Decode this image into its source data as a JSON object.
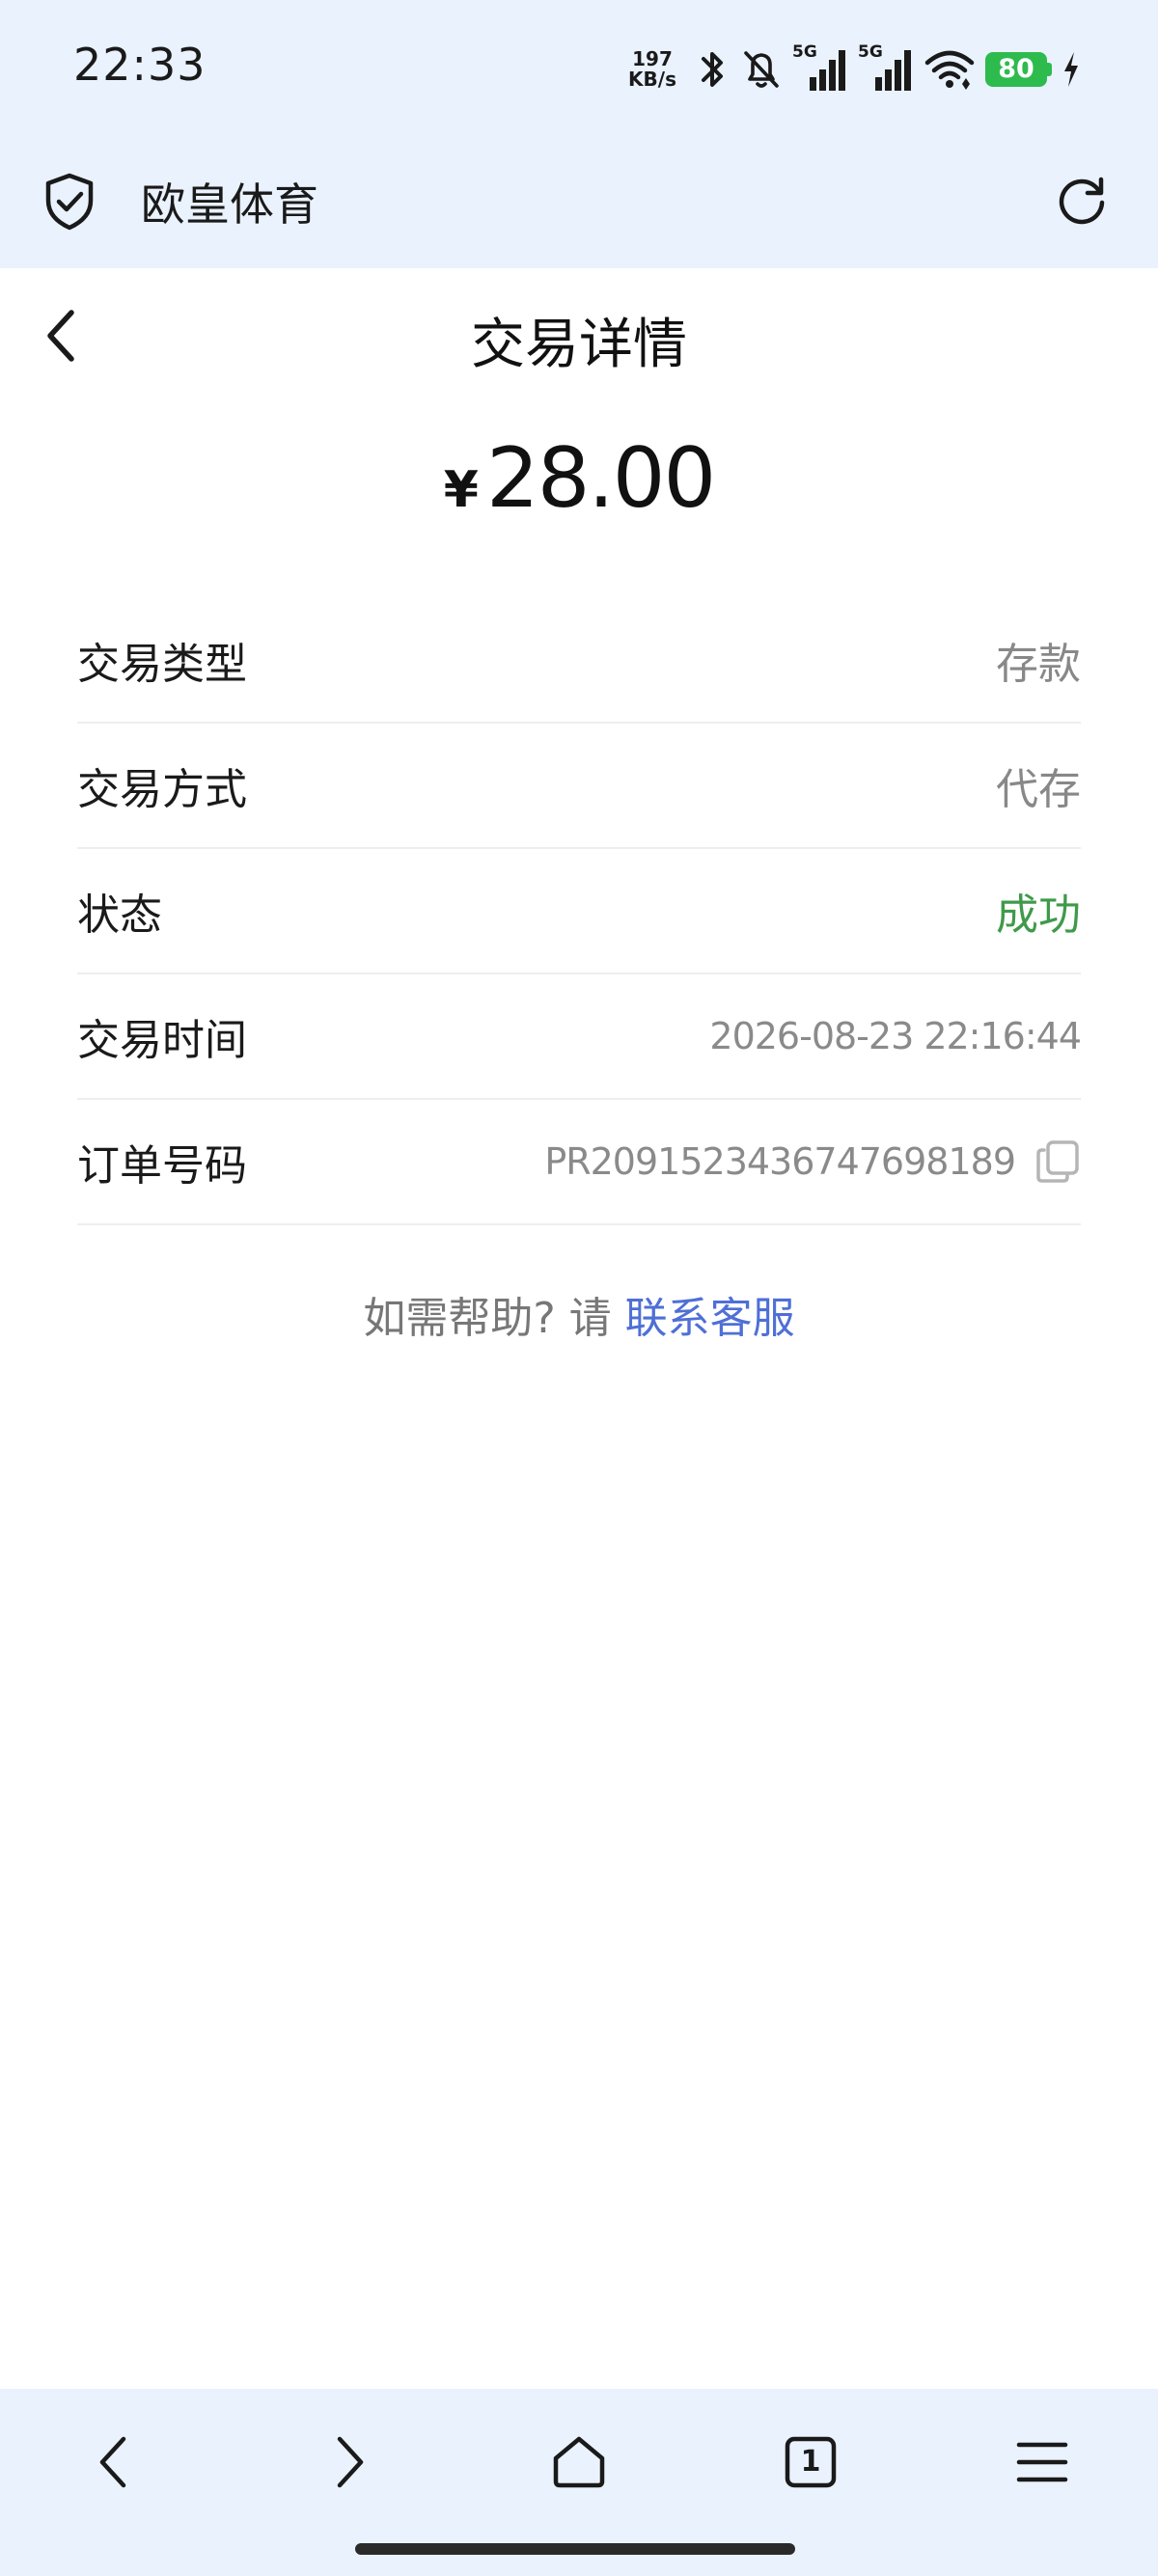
{
  "status_bar": {
    "time": "22:33",
    "net_speed_value": "197",
    "net_speed_unit": "KB/s",
    "sim1_label": "5G",
    "sim2_label": "5G",
    "battery_level": "80"
  },
  "browser_header": {
    "site_title": "欧皇体育"
  },
  "page": {
    "title": "交易详情",
    "amount_currency": "¥",
    "amount_value": "28.00"
  },
  "details": {
    "rows": [
      {
        "label": "交易类型",
        "value": "存款"
      },
      {
        "label": "交易方式",
        "value": "代存"
      },
      {
        "label": "状态",
        "value": "成功"
      },
      {
        "label": "交易时间",
        "value": "2026-08-23 22:16:44"
      },
      {
        "label": "订单号码",
        "value": "PR2091523436747698189"
      }
    ]
  },
  "help": {
    "prefix": "如需帮助? 请 ",
    "link_label": "联系客服"
  },
  "bottom_bar": {
    "tab_count": "1"
  },
  "colors": {
    "bar_background": "#eaf2fd",
    "success": "#3f9a4a",
    "link": "#4f6fd6",
    "battery": "#2dbb4e"
  }
}
